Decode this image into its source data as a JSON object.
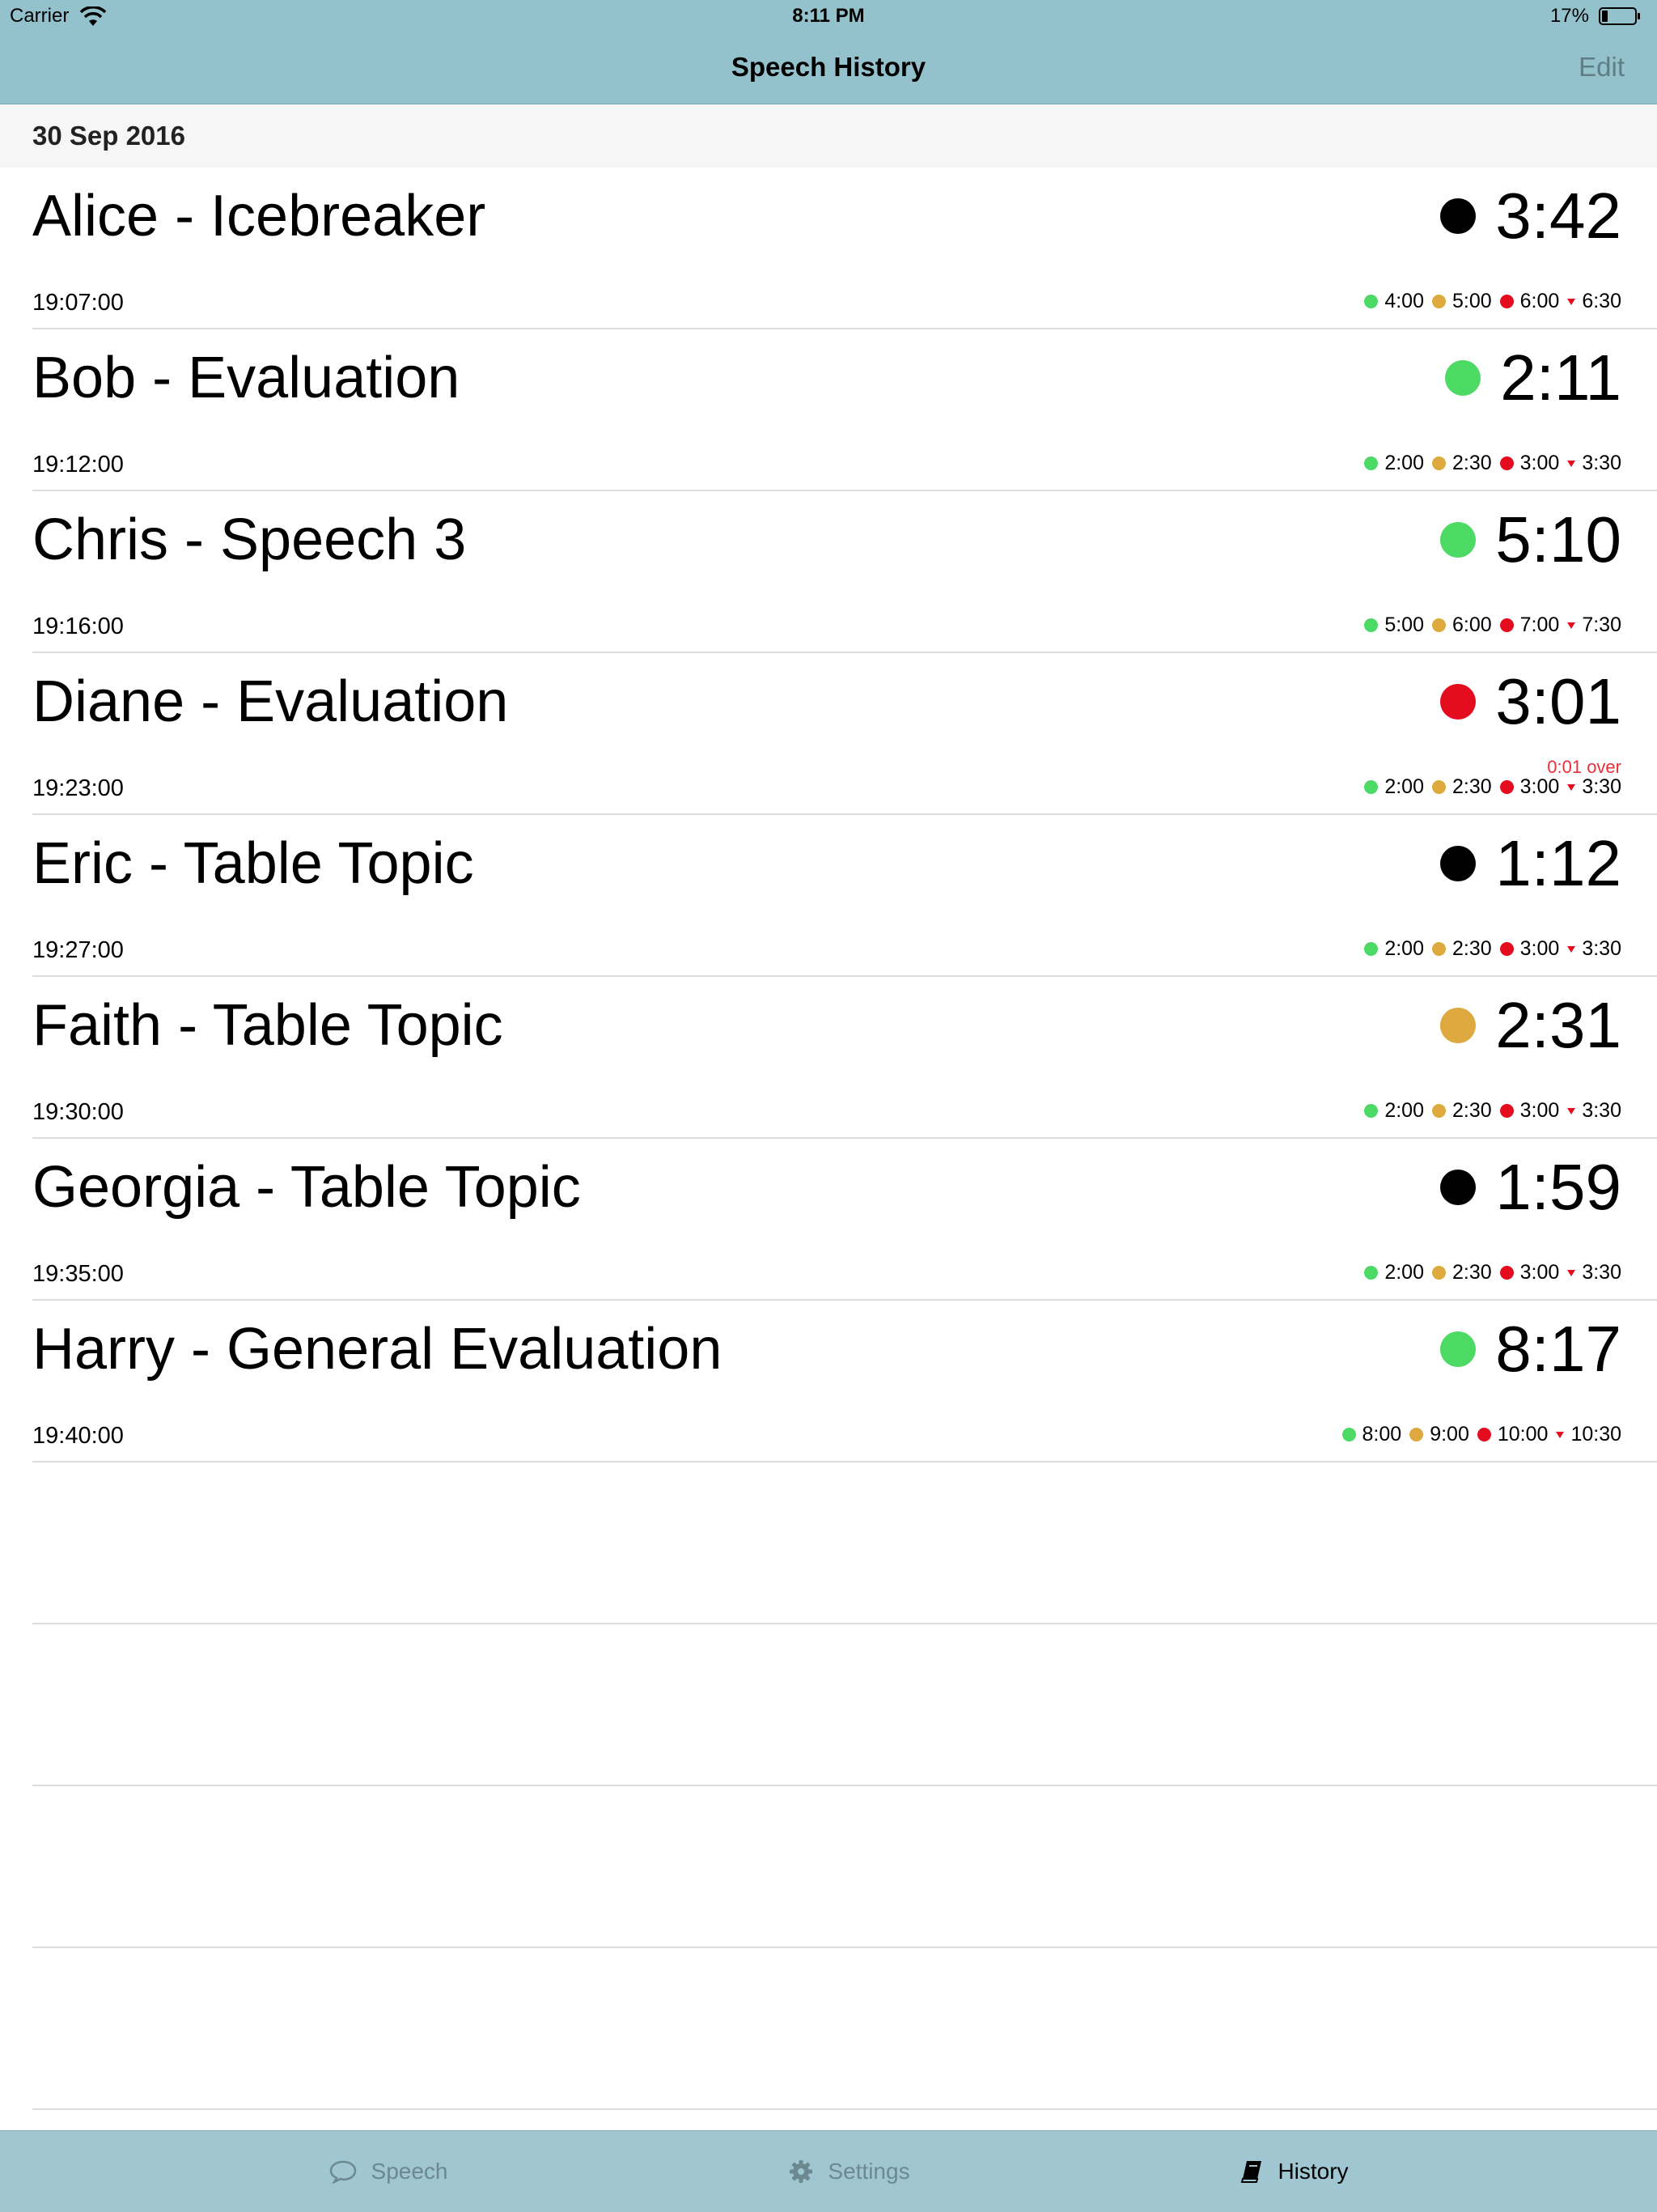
{
  "status_bar": {
    "carrier": "Carrier",
    "time": "8:11 PM",
    "battery": "17%"
  },
  "nav": {
    "title": "Speech History",
    "edit_label": "Edit"
  },
  "section": {
    "date": "30 Sep 2016"
  },
  "colors": {
    "green": "#4cd964",
    "amber": "#dea93e",
    "red": "#e40c1f",
    "black": "#000000",
    "bar": "#93c1cc"
  },
  "speeches": [
    {
      "name": "Alice - Icebreaker",
      "start": "19:07:00",
      "elapsed": "3:42",
      "status": "black",
      "thresholds": {
        "green": "4:00",
        "amber": "5:00",
        "red": "6:00",
        "max": "6:30"
      }
    },
    {
      "name": "Bob - Evaluation",
      "start": "19:12:00",
      "elapsed": "2:11",
      "status": "green",
      "thresholds": {
        "green": "2:00",
        "amber": "2:30",
        "red": "3:00",
        "max": "3:30"
      }
    },
    {
      "name": "Chris - Speech 3",
      "start": "19:16:00",
      "elapsed": "5:10",
      "status": "green",
      "thresholds": {
        "green": "5:00",
        "amber": "6:00",
        "red": "7:00",
        "max": "7:30"
      }
    },
    {
      "name": "Diane - Evaluation",
      "start": "19:23:00",
      "elapsed": "3:01",
      "status": "red",
      "over": "0:01 over",
      "thresholds": {
        "green": "2:00",
        "amber": "2:30",
        "red": "3:00",
        "max": "3:30"
      }
    },
    {
      "name": "Eric - Table Topic",
      "start": "19:27:00",
      "elapsed": "1:12",
      "status": "black",
      "thresholds": {
        "green": "2:00",
        "amber": "2:30",
        "red": "3:00",
        "max": "3:30"
      }
    },
    {
      "name": "Faith - Table Topic",
      "start": "19:30:00",
      "elapsed": "2:31",
      "status": "amber",
      "thresholds": {
        "green": "2:00",
        "amber": "2:30",
        "red": "3:00",
        "max": "3:30"
      }
    },
    {
      "name": "Georgia - Table Topic",
      "start": "19:35:00",
      "elapsed": "1:59",
      "status": "black",
      "thresholds": {
        "green": "2:00",
        "amber": "2:30",
        "red": "3:00",
        "max": "3:30"
      }
    },
    {
      "name": "Harry - General Evaluation",
      "start": "19:40:00",
      "elapsed": "8:17",
      "status": "green",
      "thresholds": {
        "green": "8:00",
        "amber": "9:00",
        "red": "10:00",
        "max": "10:30"
      }
    }
  ],
  "tabs": [
    {
      "label": "Speech",
      "icon": "speech-bubble-icon",
      "active": false
    },
    {
      "label": "Settings",
      "icon": "gear-icon",
      "active": false
    },
    {
      "label": "History",
      "icon": "book-icon",
      "active": true
    }
  ]
}
